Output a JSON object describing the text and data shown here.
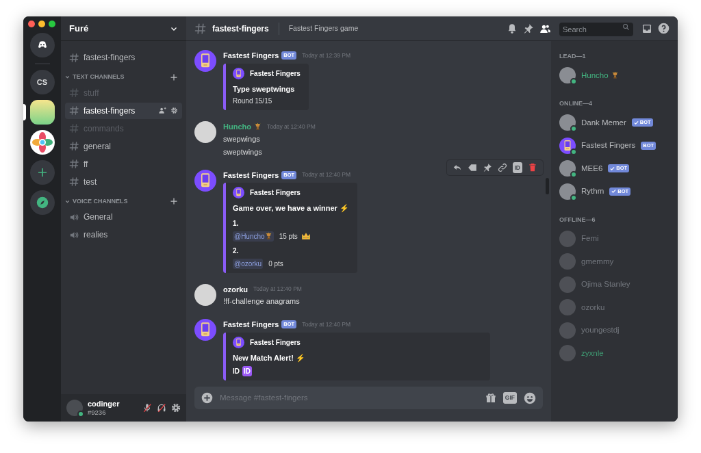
{
  "servers": [
    {
      "kind": "home",
      "selected": false
    },
    {
      "kind": "initials",
      "label": "CS",
      "selected": false
    },
    {
      "kind": "picture",
      "selected": true
    },
    {
      "kind": "logo",
      "selected": false
    },
    {
      "kind": "add",
      "selected": false
    },
    {
      "kind": "explore",
      "selected": false
    }
  ],
  "sidebar": {
    "server_name": "Furé",
    "top_channels": [
      {
        "name": "fastest-fingers",
        "kind": "text",
        "selected": false,
        "muted": false
      }
    ],
    "categories": [
      {
        "name": "TEXT CHANNELS",
        "channels": [
          {
            "name": "stuff",
            "kind": "text",
            "selected": false,
            "muted": true
          },
          {
            "name": "fastest-fingers",
            "kind": "text",
            "selected": true,
            "muted": false
          },
          {
            "name": "commands",
            "kind": "text",
            "selected": false,
            "muted": true
          },
          {
            "name": "general",
            "kind": "text",
            "selected": false,
            "muted": false
          },
          {
            "name": "ff",
            "kind": "text",
            "selected": false,
            "muted": false
          },
          {
            "name": "test",
            "kind": "text",
            "selected": false,
            "muted": false
          }
        ]
      },
      {
        "name": "VOICE CHANNELS",
        "channels": [
          {
            "name": "General",
            "kind": "voice",
            "selected": false,
            "muted": false
          },
          {
            "name": "realies",
            "kind": "voice",
            "selected": false,
            "muted": false
          }
        ]
      }
    ],
    "user": {
      "name": "codinger",
      "tag": "#9236",
      "online": true,
      "mic_muted": true,
      "deafened": true
    }
  },
  "header": {
    "channel": "fastest-fingers",
    "topic": "Fastest Fingers game",
    "search_placeholder": "Search"
  },
  "message_toolbar": {
    "id_label": "ID"
  },
  "messages": [
    {
      "kind": "bot",
      "author": "Fastest Fingers",
      "color": "#ffffff",
      "badge": "BOT",
      "role_icon": false,
      "time": "Today at 12:39 PM",
      "hovered": false,
      "embed": {
        "author": "Fastest Fingers",
        "fields": [
          {
            "kind": "heading",
            "text": "Type sweptwings"
          },
          {
            "kind": "plain",
            "text": "Round 15/15"
          }
        ]
      }
    },
    {
      "kind": "user",
      "author": "Huncho",
      "color": "#43b581",
      "role_icon": true,
      "time": "Today at 12:40 PM",
      "hovered": false,
      "lines": [
        "swepwings",
        "sweptwings"
      ]
    },
    {
      "kind": "bot",
      "author": "Fastest Fingers",
      "color": "#ffffff",
      "badge": "BOT",
      "role_icon": false,
      "time": "Today at 12:40 PM",
      "hovered": true,
      "embed": {
        "author": "Fastest Fingers",
        "fields": [
          {
            "kind": "heading",
            "text": "Game over, we have a winner",
            "emoji": "⚡"
          },
          {
            "kind": "rank",
            "text": "1."
          },
          {
            "kind": "score",
            "mention": "@Huncho",
            "role_icon": true,
            "text": "15 pts",
            "crown": true
          },
          {
            "kind": "rank",
            "text": "2."
          },
          {
            "kind": "score",
            "mention": "@ozorku",
            "role_icon": false,
            "text": "0 pts",
            "crown": false
          }
        ]
      }
    },
    {
      "kind": "user",
      "author": "ozorku",
      "color": "#ffffff",
      "role_icon": false,
      "time": "Today at 12:40 PM",
      "hovered": false,
      "lines": [
        "!ff-challenge anagrams"
      ]
    },
    {
      "kind": "bot",
      "author": "Fastest Fingers",
      "color": "#ffffff",
      "badge": "BOT",
      "role_icon": false,
      "time": "Today at 12:40 PM",
      "hovered": false,
      "embed": {
        "author": "Fastest Fingers",
        "fields": [
          {
            "kind": "heading",
            "text": "New Match Alert!",
            "emoji": "⚡"
          },
          {
            "kind": "id",
            "text": "ID",
            "tag": "ID"
          }
        ]
      }
    }
  ],
  "composer": {
    "placeholder": "Message #fastest-fingers",
    "gif_label": "GIF"
  },
  "members": [
    {
      "title": "LEAD—1",
      "items": [
        {
          "kind": "user",
          "name": "Huncho",
          "color": "#43b581",
          "online": true,
          "role_icon": true
        }
      ]
    },
    {
      "title": "ONLINE—4",
      "items": [
        {
          "kind": "user",
          "name": "Dank Memer",
          "color": "#b9bbbe",
          "online": true,
          "role_icon": false,
          "badge": "BOT",
          "verified": true
        },
        {
          "kind": "bot",
          "name": "Fastest Fingers",
          "color": "#b9bbbe",
          "online": true,
          "role_icon": false,
          "badge": "BOT",
          "verified": false
        },
        {
          "kind": "user",
          "name": "MEE6",
          "color": "#b9bbbe",
          "online": true,
          "role_icon": false,
          "badge": "BOT",
          "verified": true
        },
        {
          "kind": "user",
          "name": "Rythm",
          "color": "#b9bbbe",
          "online": true,
          "role_icon": false,
          "badge": "BOT",
          "verified": true
        }
      ]
    },
    {
      "title": "OFFLINE—6",
      "items": [
        {
          "kind": "user",
          "name": "Femi",
          "color": "#72767d",
          "online": false,
          "role_icon": false
        },
        {
          "kind": "user",
          "name": "gmemmy",
          "color": "#72767d",
          "online": false,
          "role_icon": false
        },
        {
          "kind": "user",
          "name": "Ojima Stanley",
          "color": "#72767d",
          "online": false,
          "role_icon": false
        },
        {
          "kind": "user",
          "name": "ozorku",
          "color": "#72767d",
          "online": false,
          "role_icon": false
        },
        {
          "kind": "user",
          "name": "youngestdj",
          "color": "#72767d",
          "online": false,
          "role_icon": false
        },
        {
          "kind": "user",
          "name": "zyxnle",
          "color": "#3f9d74",
          "online": false,
          "role_icon": false
        }
      ]
    }
  ]
}
